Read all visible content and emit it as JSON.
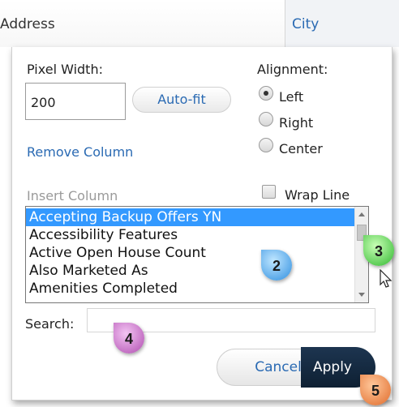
{
  "header": {
    "address_label": "Address",
    "city_label": "City"
  },
  "column_settings": {
    "pixel_width_label": "Pixel Width:",
    "pixel_width_value": "200",
    "autofit_label": "Auto-fit",
    "remove_column_label": "Remove Column",
    "alignment_label": "Alignment:",
    "alignment_options": [
      "Left",
      "Right",
      "Center"
    ],
    "alignment_selected": "Left",
    "wrap_line_label": "Wrap Line",
    "insert_column_label": "Insert Column",
    "insert_column_options": [
      "Accepting Backup Offers YN",
      "Accessibility Features",
      "Active Open House Count",
      "Also Marketed As",
      "Amenities Completed"
    ],
    "insert_column_selected": "Accepting Backup Offers YN",
    "search_label": "Search:",
    "search_value": "",
    "cancel_label": "Cancel",
    "apply_label": "Apply"
  },
  "callouts": [
    "2",
    "3",
    "4",
    "5"
  ],
  "colors": {
    "link_blue": "#2a6ab3",
    "selection_blue": "#3399ff",
    "apply_dark": "#132a40"
  }
}
